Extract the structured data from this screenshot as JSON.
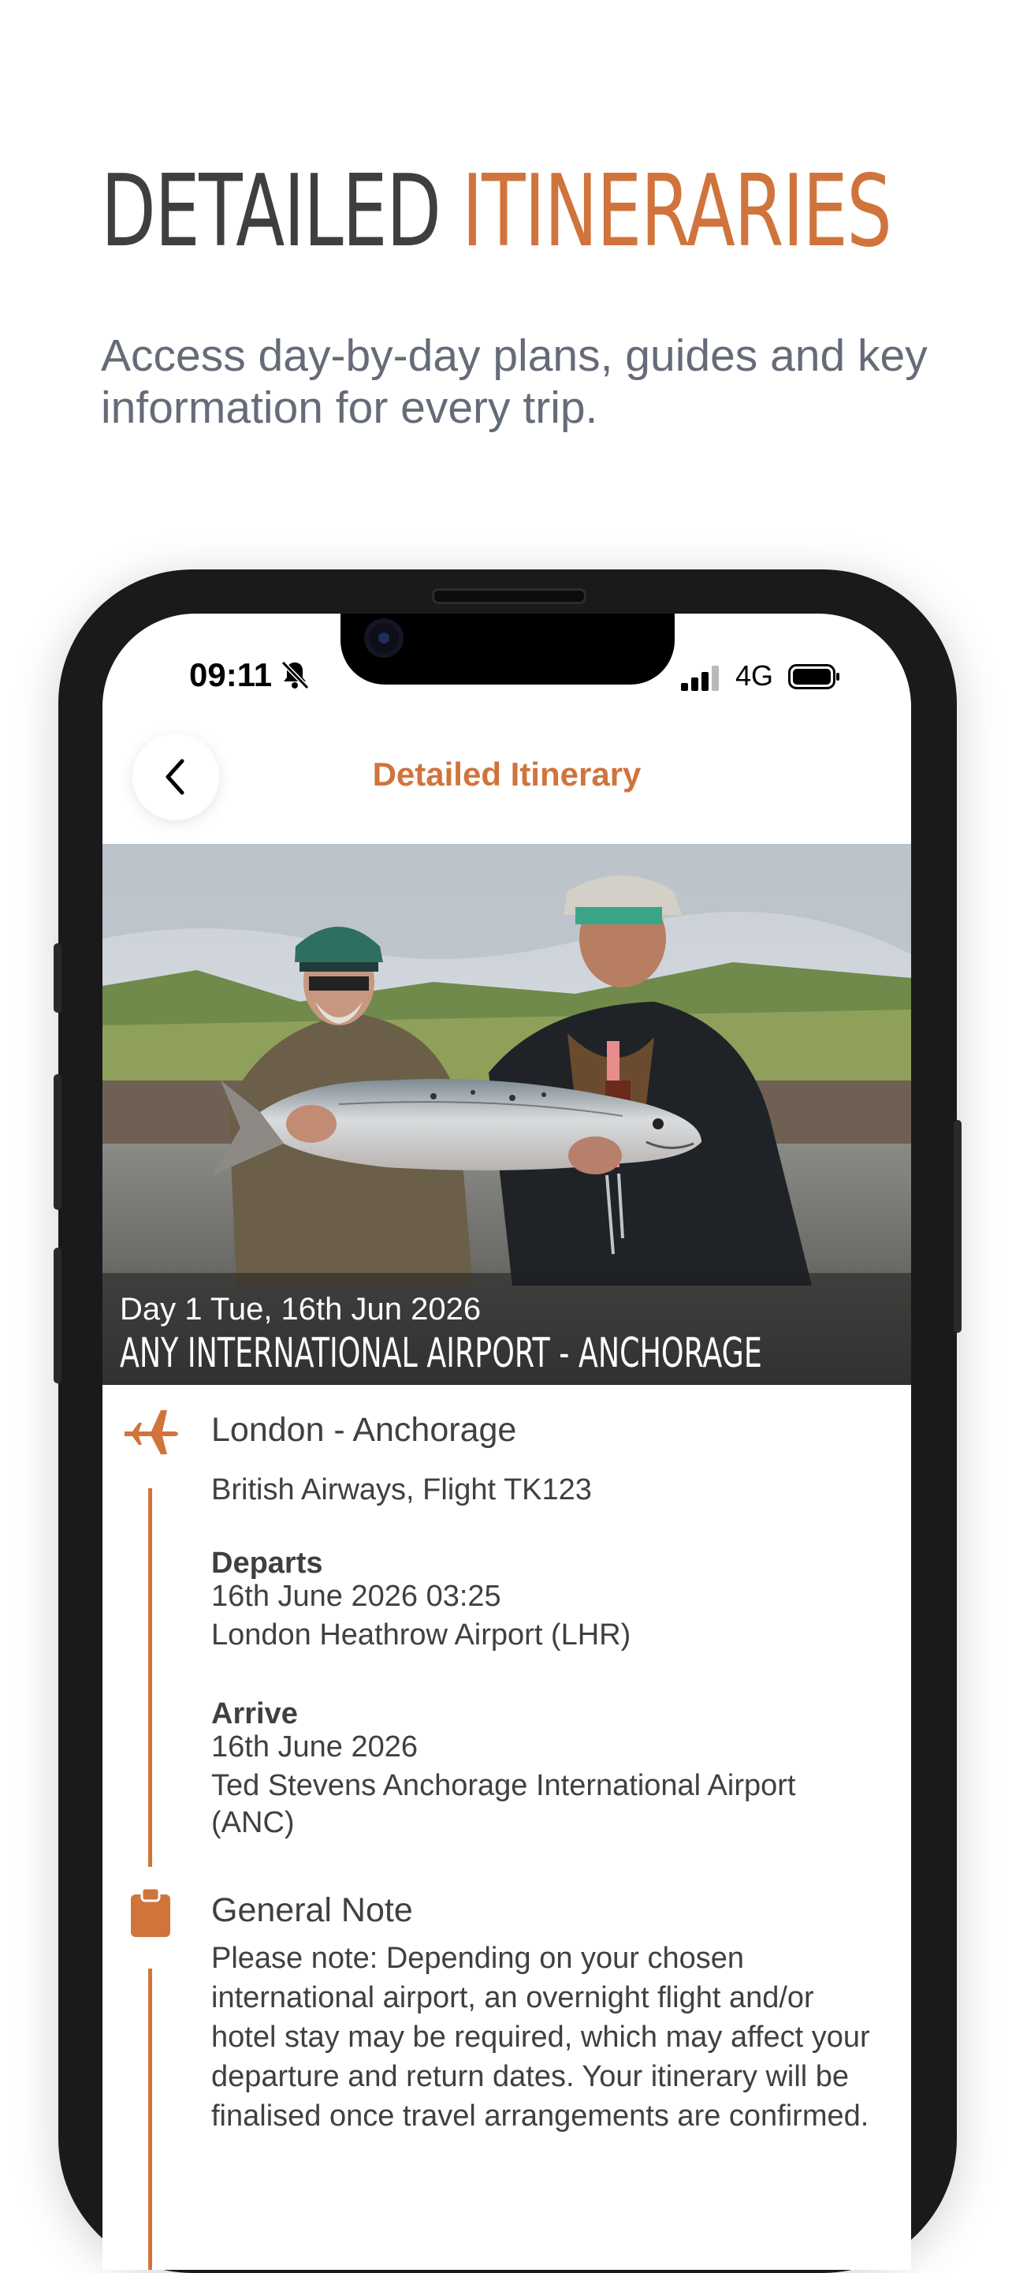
{
  "marketing": {
    "headline_part1": "DETAILED",
    "headline_part2": "ITINERARIES",
    "subheadline": "Access day-by-day plans, guides and key information for every trip."
  },
  "status_bar": {
    "time": "09:11",
    "network": "4G"
  },
  "nav": {
    "title": "Detailed Itinerary"
  },
  "hero": {
    "day": "Day 1 Tue, 16th Jun 2026",
    "route": "ANY INTERNATIONAL AIRPORT - ANCHORAGE"
  },
  "flight": {
    "title": "London - Anchorage",
    "carrier": "British Airways, Flight TK123",
    "departs_label": "Departs",
    "departs_datetime": "16th June 2026 03:25",
    "departs_airport": "London Heathrow Airport (LHR)",
    "arrive_label": "Arrive",
    "arrive_date": "16th June 2026",
    "arrive_airport_line1": "Ted Stevens Anchorage International Airport",
    "arrive_airport_line2": "(ANC)"
  },
  "note": {
    "title": "General Note",
    "body": "Please note: Depending on your chosen international airport, an overnight flight and/or hotel stay may be required, which may affect your departure and return dates. Your itinerary will be finalised once travel arrangements are confirmed."
  },
  "colors": {
    "accent": "#d0743c",
    "headline_dark": "#3f3f40",
    "subheadline": "#656b78",
    "body_text": "#404040"
  },
  "icons": {
    "flight": "airplane-icon",
    "note": "clipboard-icon",
    "back": "chevron-left-icon",
    "bell": "bell-slash-icon",
    "signal": "signal-icon",
    "battery": "battery-icon"
  }
}
